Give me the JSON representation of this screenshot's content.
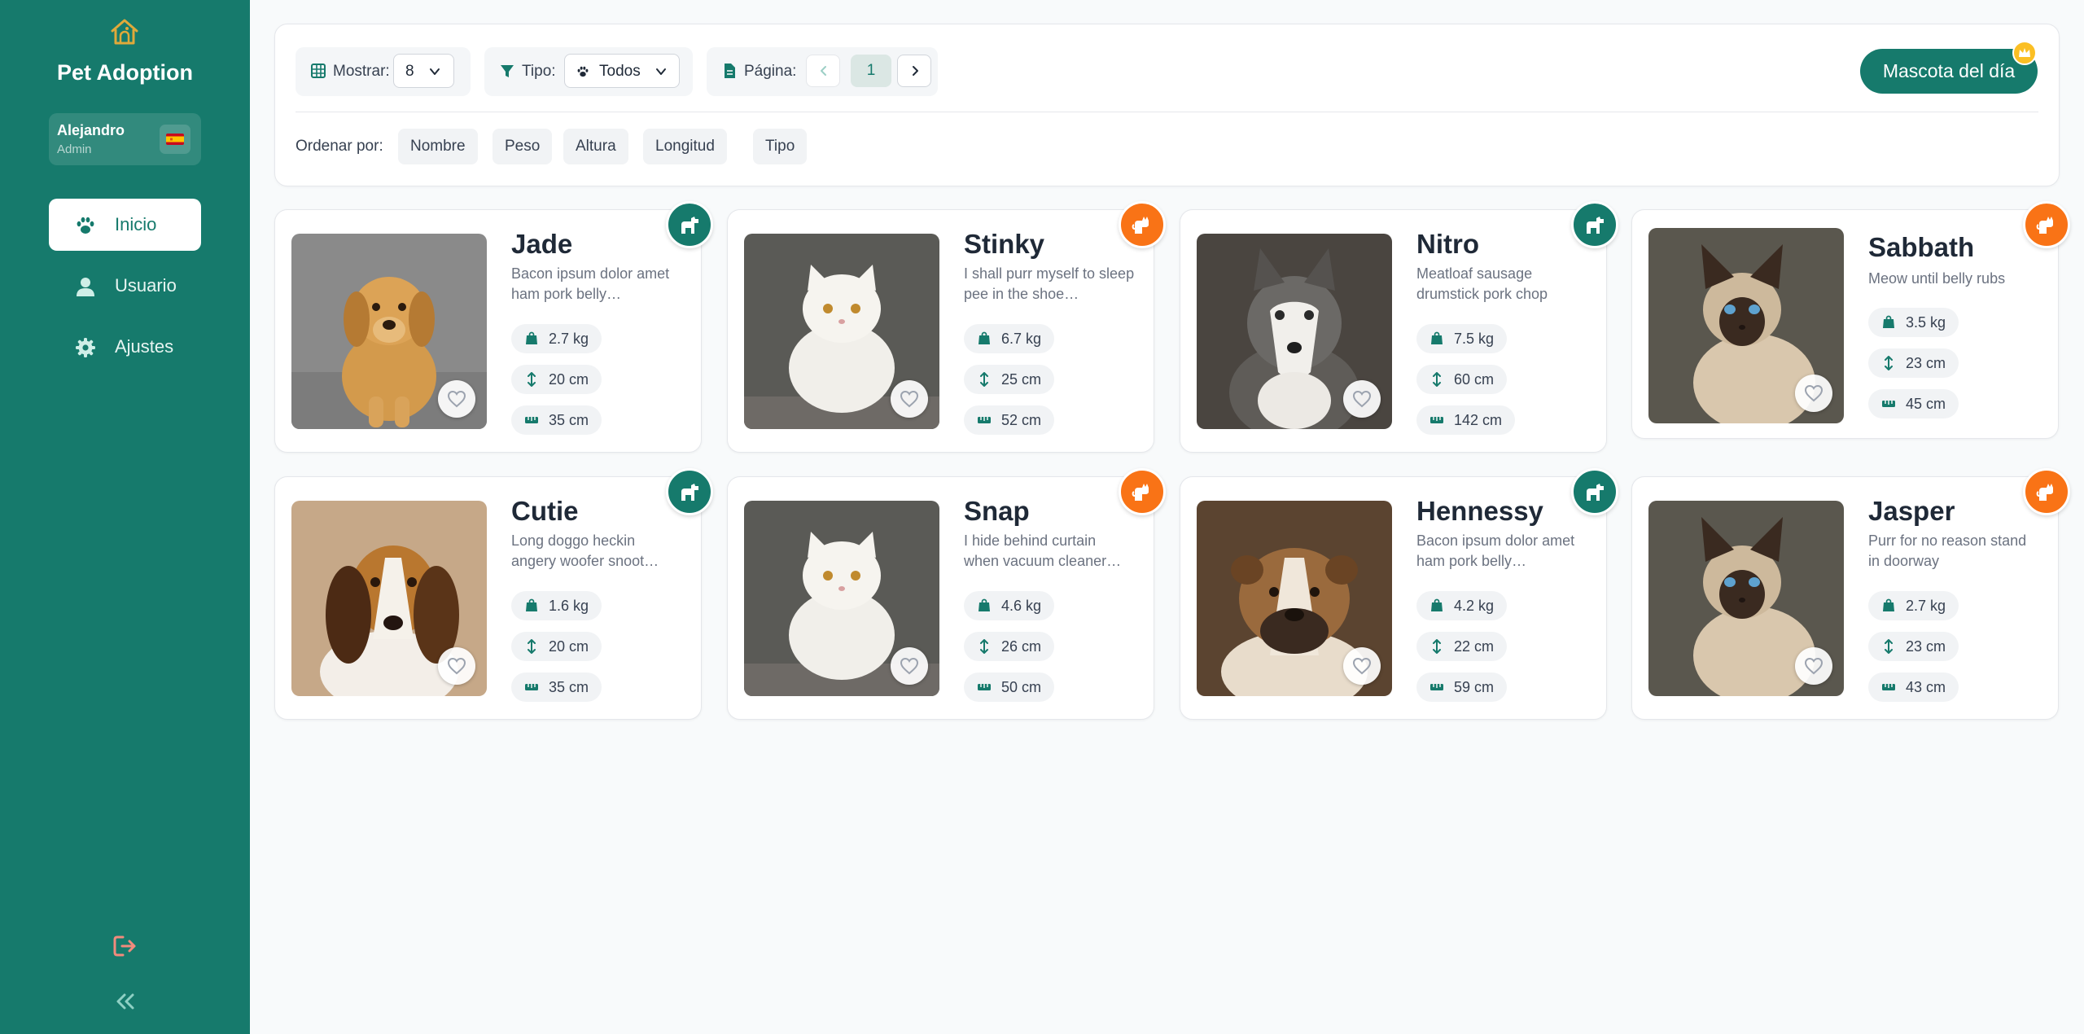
{
  "app": {
    "title": "Pet Adoption"
  },
  "user": {
    "name": "Alejandro",
    "role": "Admin"
  },
  "nav": [
    {
      "label": "Inicio",
      "icon": "paw-icon",
      "active": true
    },
    {
      "label": "Usuario",
      "icon": "user-icon",
      "active": false
    },
    {
      "label": "Ajustes",
      "icon": "gear-icon",
      "active": false
    }
  ],
  "toolbar": {
    "show_label": "Mostrar:",
    "show_value": "8",
    "type_label": "Tipo:",
    "type_value": "Todos",
    "page_label": "Página:",
    "page_value": "1",
    "sort_label": "Ordenar por:",
    "sort_options": [
      "Nombre",
      "Peso",
      "Altura",
      "Longitud",
      "Tipo"
    ],
    "motd_label": "Mascota del día"
  },
  "colors": {
    "primary": "#167a6c",
    "dog_badge": "#167a6c",
    "cat_badge": "#f97316",
    "crown": "#fbbf24"
  },
  "pets": [
    {
      "name": "Jade",
      "type": "dog",
      "desc": "Bacon ipsum dolor amet ham pork belly…",
      "weight": "2.7 kg",
      "height": "20 cm",
      "length": "35 cm"
    },
    {
      "name": "Stinky",
      "type": "cat",
      "desc": "I shall purr myself to sleep pee in the shoe…",
      "weight": "6.7 kg",
      "height": "25 cm",
      "length": "52 cm"
    },
    {
      "name": "Nitro",
      "type": "dog",
      "desc": "Meatloaf sausage drumstick pork chop",
      "weight": "7.5 kg",
      "height": "60 cm",
      "length": "142 cm"
    },
    {
      "name": "Sabbath",
      "type": "cat",
      "desc": "Meow until belly rubs",
      "weight": "3.5 kg",
      "height": "23 cm",
      "length": "45 cm"
    },
    {
      "name": "Cutie",
      "type": "dog",
      "desc": "Long doggo heckin angery woofer snoot…",
      "weight": "1.6 kg",
      "height": "20 cm",
      "length": "35 cm"
    },
    {
      "name": "Snap",
      "type": "cat",
      "desc": "I hide behind curtain when vacuum cleaner…",
      "weight": "4.6 kg",
      "height": "26 cm",
      "length": "50 cm"
    },
    {
      "name": "Hennessy",
      "type": "dog",
      "desc": "Bacon ipsum dolor amet ham pork belly…",
      "weight": "4.2 kg",
      "height": "22 cm",
      "length": "59 cm"
    },
    {
      "name": "Jasper",
      "type": "cat",
      "desc": "Purr for no reason stand in doorway",
      "weight": "2.7 kg",
      "height": "23 cm",
      "length": "43 cm"
    }
  ]
}
